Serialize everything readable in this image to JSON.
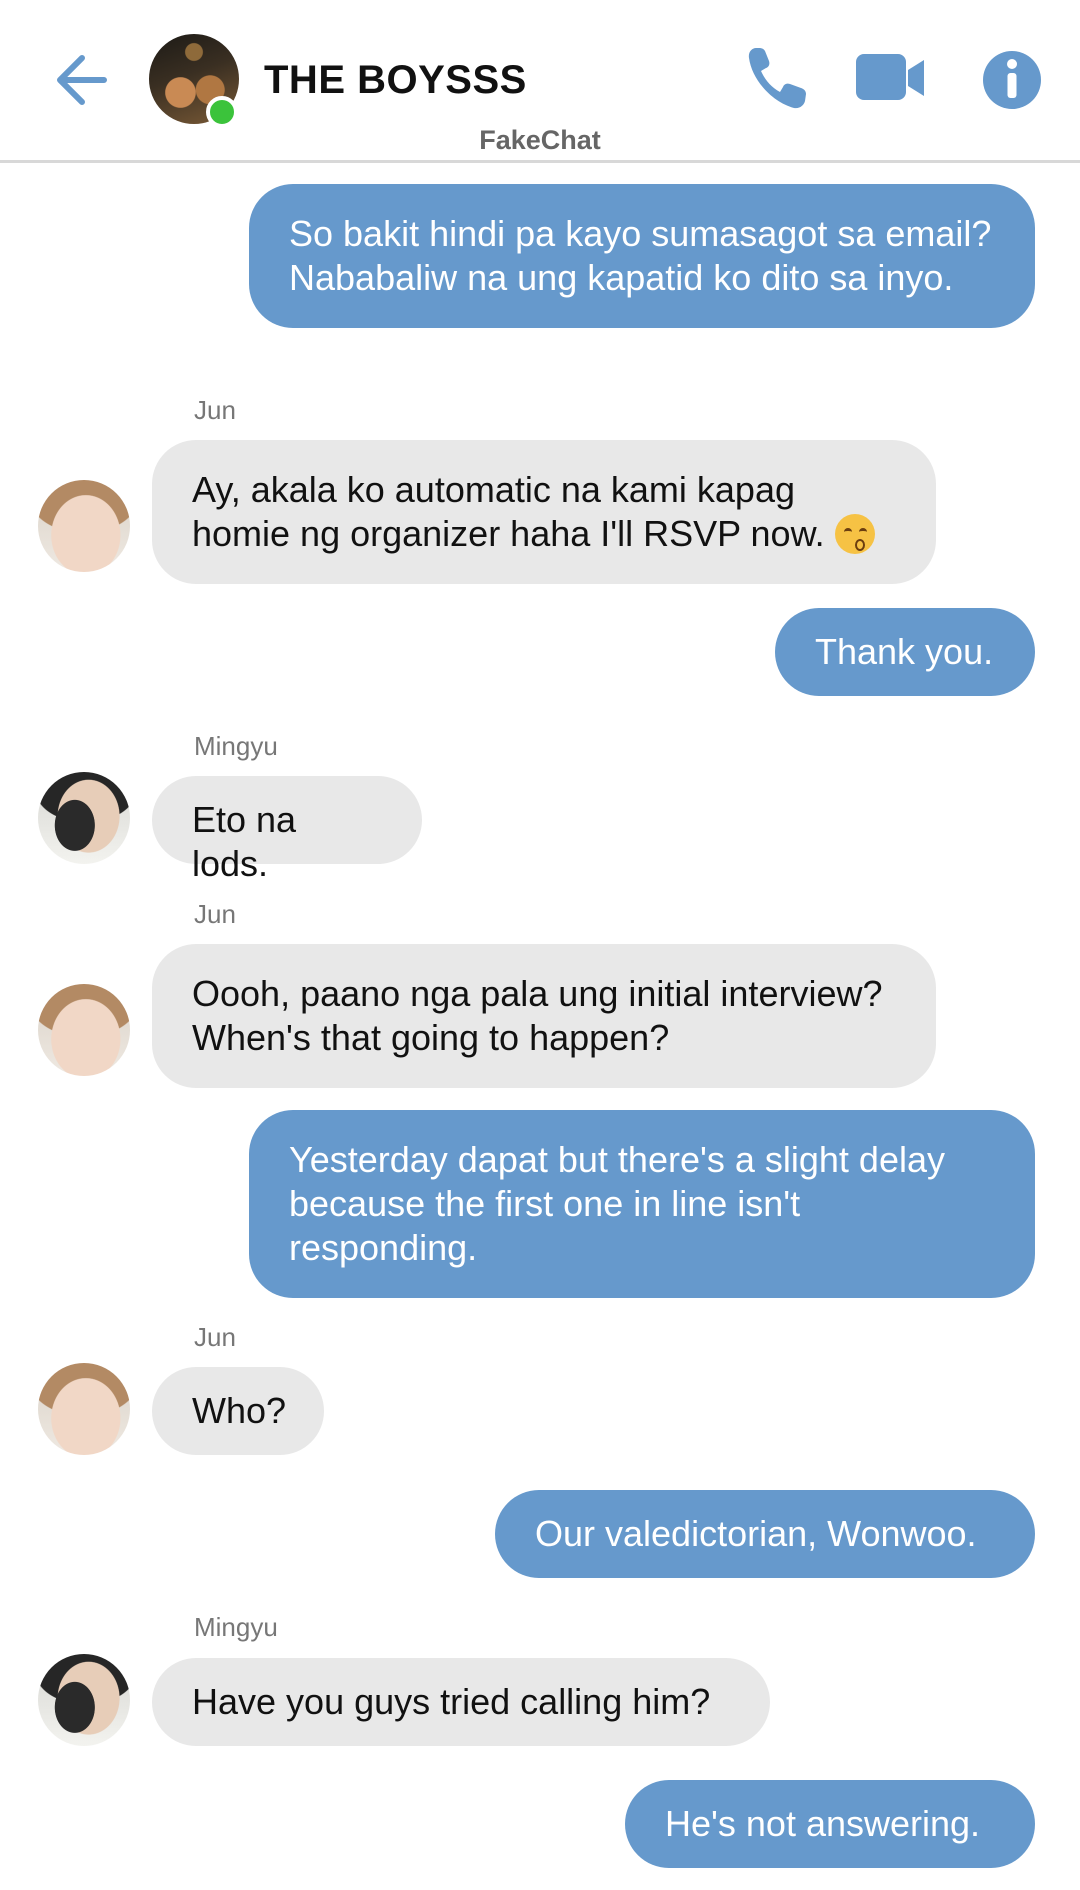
{
  "header": {
    "title": "THE BOYSSS",
    "subtitle": "FakeChat",
    "accent_color": "#6699cc",
    "online_color": "#3bc33b",
    "icons": [
      "back-arrow-icon",
      "phone-icon",
      "video-camera-icon",
      "info-icon"
    ]
  },
  "messages": [
    {
      "side": "out",
      "text": "So bakit hindi pa kayo sumasagot sa email? Nababaliw na ung kapatid ko dito sa inyo."
    },
    {
      "side": "in",
      "sender": "Jun",
      "text": "Ay, akala ko automatic na kami kapag homie ng organizer haha I'll RSVP now."
    },
    {
      "side": "out",
      "text": "Thank you."
    },
    {
      "side": "in",
      "sender": "Mingyu",
      "text": "Eto na lods."
    },
    {
      "side": "in",
      "sender": "Jun",
      "text": "Oooh, paano nga pala ung initial interview? When's that going to happen?"
    },
    {
      "side": "out",
      "text": "Yesterday dapat but there's a slight delay because the first one in line isn't responding."
    },
    {
      "side": "in",
      "sender": "Jun",
      "text": "Who?"
    },
    {
      "side": "out",
      "text": "Our valedictorian, Wonwoo."
    },
    {
      "side": "in",
      "sender": "Mingyu",
      "text": "Have you guys tried calling him?"
    },
    {
      "side": "out",
      "text": "He's not answering."
    }
  ],
  "colors": {
    "outgoing_bubble": "#6699cc",
    "incoming_bubble": "#e8e8e8"
  }
}
